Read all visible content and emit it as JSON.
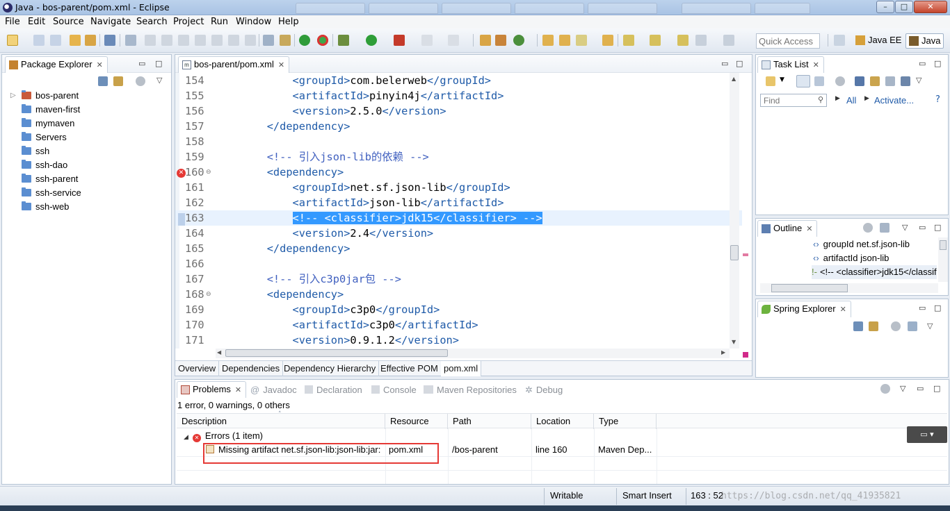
{
  "window": {
    "title": "Java - bos-parent/pom.xml - Eclipse",
    "min": "–",
    "max": "□",
    "close": "✕"
  },
  "menu": [
    "File",
    "Edit",
    "Source",
    "Navigate",
    "Search",
    "Project",
    "Run",
    "Window",
    "Help"
  ],
  "toolbar": {
    "quick_access_placeholder": "Quick Access",
    "perspectives": [
      "Java EE",
      "Java"
    ]
  },
  "package_explorer": {
    "title": "Package Explorer",
    "items": [
      "bos-parent",
      "maven-first",
      "mymaven",
      "Servers",
      "ssh",
      "ssh-dao",
      "ssh-parent",
      "ssh-service",
      "ssh-web"
    ]
  },
  "editor": {
    "tab": "pom.xml",
    "tab_label": "bos-parent/pom.xml",
    "lines": [
      {
        "n": "154",
        "indent": "            ",
        "parts": [
          [
            "tg",
            "<groupId>"
          ],
          [
            "tx",
            "com.belerweb"
          ],
          [
            "tg",
            "</groupId>"
          ]
        ]
      },
      {
        "n": "155",
        "indent": "            ",
        "parts": [
          [
            "tg",
            "<artifactId>"
          ],
          [
            "tx",
            "pinyin4j"
          ],
          [
            "tg",
            "</artifactId>"
          ]
        ]
      },
      {
        "n": "156",
        "indent": "            ",
        "parts": [
          [
            "tg",
            "<version>"
          ],
          [
            "tx",
            "2.5.0"
          ],
          [
            "tg",
            "</version>"
          ]
        ]
      },
      {
        "n": "157",
        "indent": "        ",
        "parts": [
          [
            "tg",
            "</dependency>"
          ]
        ]
      },
      {
        "n": "158",
        "indent": "",
        "parts": []
      },
      {
        "n": "159",
        "indent": "        ",
        "parts": [
          [
            "cm",
            "<!-- 引入json-lib的依赖 -->"
          ]
        ]
      },
      {
        "n": "160",
        "indent": "        ",
        "parts": [
          [
            "tg",
            "<dependency>"
          ]
        ]
      },
      {
        "n": "161",
        "indent": "            ",
        "parts": [
          [
            "tg",
            "<groupId>"
          ],
          [
            "tx",
            "net.sf.json-lib"
          ],
          [
            "tg",
            "</groupId>"
          ]
        ]
      },
      {
        "n": "162",
        "indent": "            ",
        "parts": [
          [
            "tg",
            "<artifactId>"
          ],
          [
            "tx",
            "json-lib"
          ],
          [
            "tg",
            "</artifactId>"
          ]
        ]
      },
      {
        "n": "163",
        "indent": "            ",
        "parts": [
          [
            "sel",
            "<!-- <classifier>jdk15</classifier> -->"
          ]
        ]
      },
      {
        "n": "164",
        "indent": "            ",
        "parts": [
          [
            "tg",
            "<version>"
          ],
          [
            "tx",
            "2.4"
          ],
          [
            "tg",
            "</version>"
          ]
        ]
      },
      {
        "n": "165",
        "indent": "        ",
        "parts": [
          [
            "tg",
            "</dependency>"
          ]
        ]
      },
      {
        "n": "166",
        "indent": "",
        "parts": []
      },
      {
        "n": "167",
        "indent": "        ",
        "parts": [
          [
            "cm",
            "<!-- 引入c3p0jar包 -->"
          ]
        ]
      },
      {
        "n": "168",
        "indent": "        ",
        "parts": [
          [
            "tg",
            "<dependency>"
          ]
        ]
      },
      {
        "n": "169",
        "indent": "            ",
        "parts": [
          [
            "tg",
            "<groupId>"
          ],
          [
            "tx",
            "c3p0"
          ],
          [
            "tg",
            "</groupId>"
          ]
        ]
      },
      {
        "n": "170",
        "indent": "            ",
        "parts": [
          [
            "tg",
            "<artifactId>"
          ],
          [
            "tx",
            "c3p0"
          ],
          [
            "tg",
            "</artifactId>"
          ]
        ]
      },
      {
        "n": "171",
        "indent": "            ",
        "parts": [
          [
            "tg",
            "<version>"
          ],
          [
            "tx",
            "0.9.1.2"
          ],
          [
            "tg",
            "</version>"
          ]
        ]
      }
    ],
    "bottom_tabs": [
      "Overview",
      "Dependencies",
      "Dependency Hierarchy",
      "Effective POM",
      "pom.xml"
    ]
  },
  "task_list": {
    "title": "Task List",
    "find_placeholder": "Find",
    "all": "All",
    "activate": "Activate..."
  },
  "outline": {
    "title": "Outline",
    "items": [
      "groupId  net.sf.json-lib",
      "artifactId  json-lib",
      "<!-- <classifier>jdk15</classifier> -->"
    ]
  },
  "spring_explorer": {
    "title": "Spring Explorer"
  },
  "problems": {
    "tabs": [
      "Problems",
      "Javadoc",
      "Declaration",
      "Console",
      "Maven Repositories",
      "Debug"
    ],
    "summary": "1 error, 0 warnings, 0 others",
    "columns": [
      "Description",
      "Resource",
      "Path",
      "Location",
      "Type"
    ],
    "group": "Errors (1 item)",
    "row": {
      "description": "Missing artifact net.sf.json-lib:json-lib:jar:",
      "resource": "pom.xml",
      "path": "/bos-parent",
      "location": "line 160",
      "type": "Maven Dep..."
    }
  },
  "status": {
    "writable": "Writable",
    "insert": "Smart Insert",
    "position": "163 : 52",
    "watermark": "https://blog.csdn.net/qq_41935821"
  },
  "colors": {
    "selection": "#3399ff",
    "tag": "#1e5aa8",
    "comment": "#3f5fbf",
    "error": "#e53935",
    "highlight_box": "#e53935"
  }
}
